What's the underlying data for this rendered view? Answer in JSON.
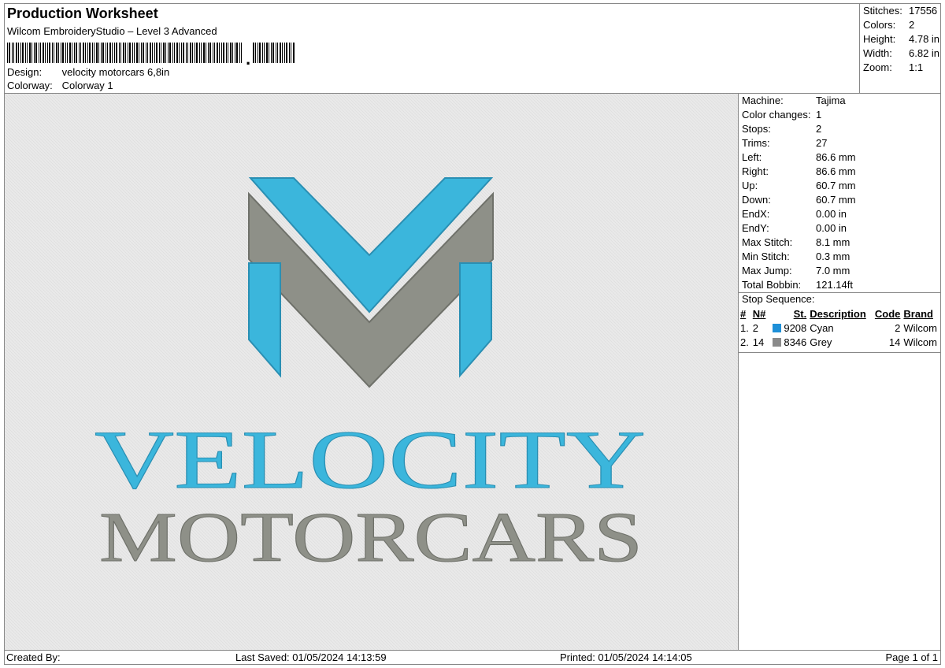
{
  "header": {
    "title": "Production Worksheet",
    "subtitle": "Wilcom EmbroideryStudio – Level 3 Advanced",
    "design_label": "Design:",
    "design_value": "velocity motorcars 6,8in",
    "colorway_label": "Colorway:",
    "colorway_value": "Colorway 1"
  },
  "stats": [
    {
      "label": "Stitches:",
      "value": "17556"
    },
    {
      "label": "Colors:",
      "value": "2"
    },
    {
      "label": "Height:",
      "value": "4.78 in"
    },
    {
      "label": "Width:",
      "value": "6.82 in"
    },
    {
      "label": "Zoom:",
      "value": "1:1"
    }
  ],
  "machine": [
    {
      "label": "Machine:",
      "value": "Tajima"
    },
    {
      "label": "Color changes:",
      "value": "1"
    },
    {
      "label": "Stops:",
      "value": "2"
    },
    {
      "label": "Trims:",
      "value": "27"
    },
    {
      "label": "Left:",
      "value": "86.6 mm"
    },
    {
      "label": "Right:",
      "value": "86.6 mm"
    },
    {
      "label": "Up:",
      "value": "60.7 mm"
    },
    {
      "label": "Down:",
      "value": "60.7 mm"
    },
    {
      "label": "EndX:",
      "value": "0.00 in"
    },
    {
      "label": "EndY:",
      "value": "0.00 in"
    },
    {
      "label": "Max Stitch:",
      "value": "8.1 mm"
    },
    {
      "label": "Min Stitch:",
      "value": "0.3 mm"
    },
    {
      "label": "Max Jump:",
      "value": "7.0 mm"
    },
    {
      "label": "Total Bobbin:",
      "value": "121.14ft"
    }
  ],
  "stop_sequence": {
    "title": "Stop Sequence:",
    "columns": [
      "#",
      "N#",
      "St.",
      "Description",
      "Code",
      "Brand"
    ],
    "rows": [
      {
        "idx": "1.",
        "n": "2",
        "color": "#1e90d8",
        "st": "9208",
        "desc": "Cyan",
        "code": "2",
        "brand": "Wilcom"
      },
      {
        "idx": "2.",
        "n": "14",
        "color": "#8a8a8a",
        "st": "8346",
        "desc": "Grey",
        "code": "14",
        "brand": "Wilcom"
      }
    ]
  },
  "artwork": {
    "line1": "VELOCITY",
    "line2": "MOTORCARS",
    "cyan": "#3bb6dc",
    "grey": "#8e9088"
  },
  "footer": {
    "created_by": "Created By:",
    "last_saved": "Last Saved: 01/05/2024 14:13:59",
    "printed": "Printed: 01/05/2024 14:14:05",
    "page": "Page 1 of 1"
  }
}
